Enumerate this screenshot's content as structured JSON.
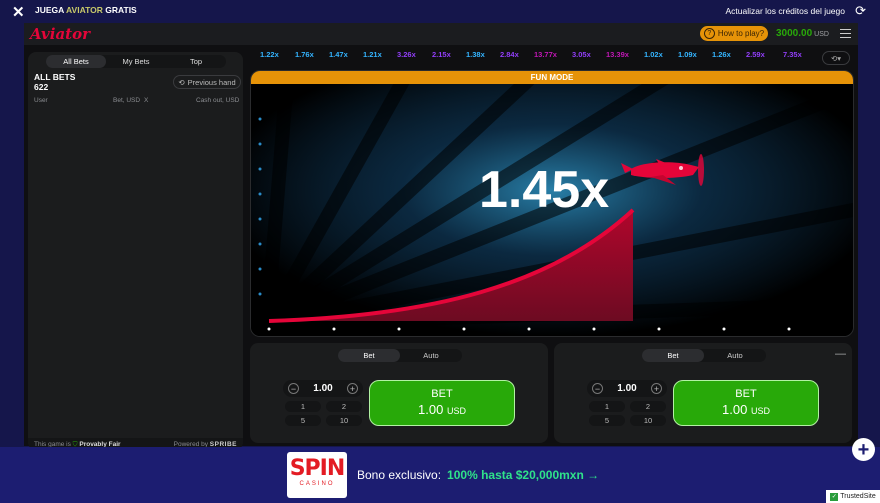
{
  "topbar": {
    "title_prefix": "JUEGA",
    "title_highlight": "AVIATOR",
    "title_suffix": "GRATIS",
    "update_label": "Actualizar los créditos del juego"
  },
  "header": {
    "logo": "Aviator",
    "how_to_play": "How to play?",
    "balance": "3000.00",
    "currency": "USD"
  },
  "bets_panel": {
    "tabs": [
      "All Bets",
      "My Bets",
      "Top"
    ],
    "all_bets_label": "ALL BETS",
    "all_bets_count": "622",
    "previous_hand": "Previous hand",
    "col_user": "User",
    "col_bet": "Bet, USD",
    "col_x": "X",
    "col_cashout": "Cash out, USD",
    "footer_prefix": "This game is",
    "footer_provably": "Provably Fair",
    "footer_powered": "Powered by",
    "footer_brand": "SPRIBE"
  },
  "multipliers": [
    {
      "value": "1.22x",
      "color": "#34b4ff"
    },
    {
      "value": "1.76x",
      "color": "#34b4ff"
    },
    {
      "value": "1.47x",
      "color": "#34b4ff"
    },
    {
      "value": "1.21x",
      "color": "#34b4ff"
    },
    {
      "value": "3.26x",
      "color": "#913ef8"
    },
    {
      "value": "2.15x",
      "color": "#913ef8"
    },
    {
      "value": "1.38x",
      "color": "#34b4ff"
    },
    {
      "value": "2.84x",
      "color": "#913ef8"
    },
    {
      "value": "13.77x",
      "color": "#c017b4"
    },
    {
      "value": "3.05x",
      "color": "#913ef8"
    },
    {
      "value": "13.39x",
      "color": "#c017b4"
    },
    {
      "value": "1.02x",
      "color": "#34b4ff"
    },
    {
      "value": "1.09x",
      "color": "#34b4ff"
    },
    {
      "value": "1.26x",
      "color": "#34b4ff"
    },
    {
      "value": "2.59x",
      "color": "#913ef8"
    },
    {
      "value": "7.35x",
      "color": "#913ef8"
    }
  ],
  "stage": {
    "mode_label": "FUN MODE",
    "current_multiplier": "1.45x"
  },
  "bet_panels": [
    {
      "tabs": [
        "Bet",
        "Auto"
      ],
      "amount": "1.00",
      "quick": [
        "1",
        "2",
        "5",
        "10"
      ],
      "button_label": "BET",
      "button_amount": "1.00",
      "button_currency": "USD"
    },
    {
      "tabs": [
        "Bet",
        "Auto"
      ],
      "amount": "1.00",
      "quick": [
        "1",
        "2",
        "5",
        "10"
      ],
      "button_label": "BET",
      "button_amount": "1.00",
      "button_currency": "USD"
    }
  ],
  "banner": {
    "logo_main": "SPIN",
    "logo_sub": "CASINO",
    "text": "Bono exclusivo:",
    "offer": "100% hasta $20,000mxn →"
  },
  "trusted_site": "TrustedSite",
  "icons": [
    "close-icon",
    "refresh-icon",
    "question-icon",
    "menu-icon",
    "history-icon",
    "shield-icon",
    "minus-icon",
    "plus-icon",
    "airplane-icon",
    "checkmark-icon"
  ]
}
